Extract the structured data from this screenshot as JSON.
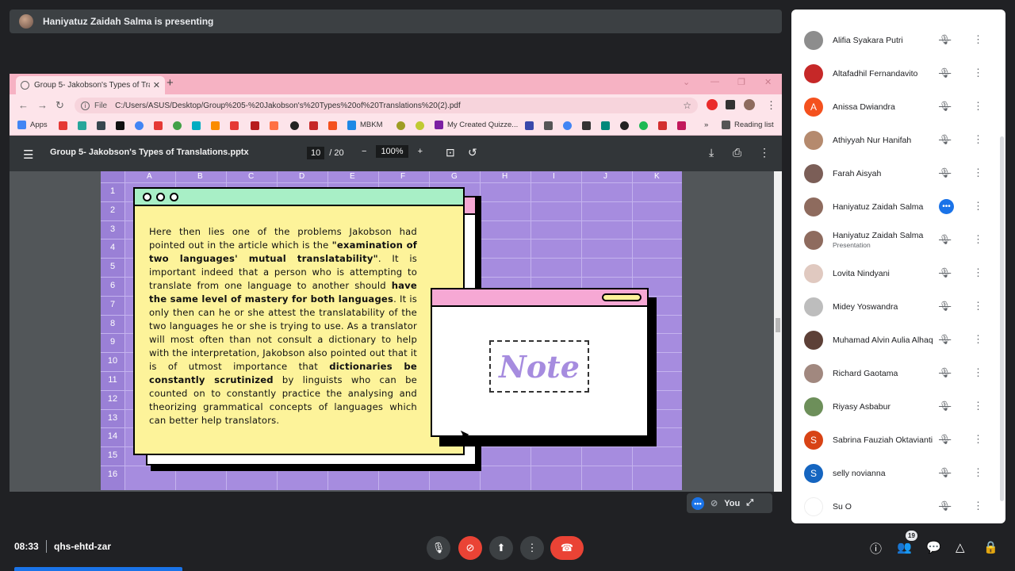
{
  "meet": {
    "presenting_text": "Haniyatuz Zaidah Salma is presenting",
    "time": "08:33",
    "meeting_code": "qhs-ehtd-zar",
    "self_label": "You",
    "participant_count": "19"
  },
  "browser": {
    "tab_title": "Group 5- Jakobson's Types of Tra",
    "file_label": "File",
    "url": "C:/Users/ASUS/Desktop/Group%205-%20Jakobson's%20Types%20of%20Translations%20(2).pdf",
    "bookmarks": [
      "Apps",
      "MBKM",
      "My Created Quizze...",
      "Reading list"
    ]
  },
  "pdf": {
    "filename": "Group 5- Jakobson's Types of Translations.pptx",
    "page": "10",
    "page_total": "/ 20",
    "zoom": "100%"
  },
  "slide": {
    "columns": [
      "A",
      "B",
      "C",
      "D",
      "E",
      "F",
      "G",
      "H",
      "I",
      "J",
      "K"
    ],
    "rows": [
      "1",
      "2",
      "3",
      "4",
      "5",
      "6",
      "7",
      "8",
      "9",
      "10",
      "11",
      "12",
      "13",
      "14",
      "15",
      "16"
    ],
    "text": {
      "p1": "Here then lies one of the problems Jakobson had pointed out in the article which is the ",
      "b1": "\"examination of two languages' mutual translatability\"",
      "p2": ". It is important indeed that a person who is attempting to translate from one language to another should ",
      "b2": "have the same level of mastery for both languages",
      "p3": ". It is only then can he or she attest the translatability of the two languages he or she is trying to use. As a translator will most often than not consult a dictionary to help with the interpretation, Jakobson also pointed out that it is of utmost importance that ",
      "b3": "dictionaries be constantly scrutinized",
      "p4": " by linguists who can be counted on to constantly practice the analysing and theorizing grammatical concepts of languages which can better help translators."
    },
    "note": "Note"
  },
  "participants": [
    {
      "name": "Alifia Syakara Putri",
      "sub": "",
      "avatar_color": "#8d8d8d",
      "initial": ""
    },
    {
      "name": "Altafadhil Fernandavito",
      "sub": "",
      "avatar_color": "#c62828",
      "initial": ""
    },
    {
      "name": "Anissa Dwiandra",
      "sub": "",
      "avatar_color": "#f4511e",
      "initial": "A"
    },
    {
      "name": "Athiyyah Nur Hanifah",
      "sub": "",
      "avatar_color": "#b58a6e",
      "initial": ""
    },
    {
      "name": "Farah Aisyah",
      "sub": "",
      "avatar_color": "#7b5e57",
      "initial": ""
    },
    {
      "name": "Haniyatuz Zaidah Salma",
      "sub": "",
      "avatar_color": "#8e6b5e",
      "initial": ""
    },
    {
      "name": "Haniyatuz Zaidah Salma",
      "sub": "Presentation",
      "avatar_color": "#8e6b5e",
      "initial": ""
    },
    {
      "name": "Lovita Nindyani",
      "sub": "",
      "avatar_color": "#e0c9c0",
      "initial": ""
    },
    {
      "name": "Midey Yoswandra",
      "sub": "",
      "avatar_color": "#bdbdbd",
      "initial": ""
    },
    {
      "name": "Muhamad Alvin Aulia Alhaq",
      "sub": "",
      "avatar_color": "#5d4037",
      "initial": ""
    },
    {
      "name": "Richard Gaotama",
      "sub": "",
      "avatar_color": "#a1887f",
      "initial": ""
    },
    {
      "name": "Riyasy Asbabur",
      "sub": "",
      "avatar_color": "#6d8f5a",
      "initial": ""
    },
    {
      "name": "Sabrina Fauziah Oktavianti",
      "sub": "",
      "avatar_color": "#d84315",
      "initial": "S"
    },
    {
      "name": "selly novianna",
      "sub": "",
      "avatar_color": "#1565c0",
      "initial": "S"
    },
    {
      "name": "Su O",
      "sub": "",
      "avatar_color": "#ffffff",
      "initial": ""
    }
  ]
}
